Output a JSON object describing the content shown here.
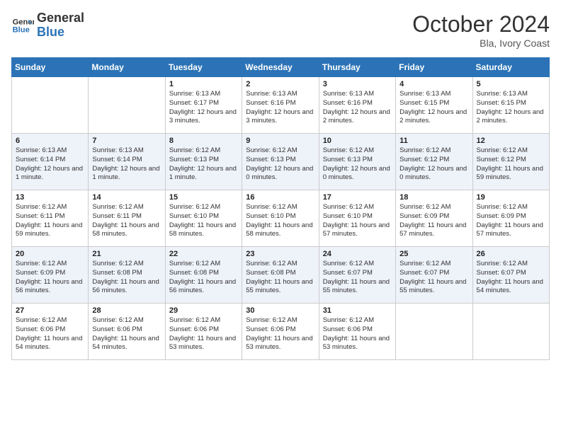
{
  "header": {
    "logo_line1": "General",
    "logo_line2": "Blue",
    "month_title": "October 2024",
    "location": "Bla, Ivory Coast"
  },
  "days_of_week": [
    "Sunday",
    "Monday",
    "Tuesday",
    "Wednesday",
    "Thursday",
    "Friday",
    "Saturday"
  ],
  "weeks": [
    [
      {
        "day": "",
        "info": ""
      },
      {
        "day": "",
        "info": ""
      },
      {
        "day": "1",
        "sunrise": "6:13 AM",
        "sunset": "6:17 PM",
        "daylight": "12 hours and 3 minutes."
      },
      {
        "day": "2",
        "sunrise": "6:13 AM",
        "sunset": "6:16 PM",
        "daylight": "12 hours and 3 minutes."
      },
      {
        "day": "3",
        "sunrise": "6:13 AM",
        "sunset": "6:16 PM",
        "daylight": "12 hours and 2 minutes."
      },
      {
        "day": "4",
        "sunrise": "6:13 AM",
        "sunset": "6:15 PM",
        "daylight": "12 hours and 2 minutes."
      },
      {
        "day": "5",
        "sunrise": "6:13 AM",
        "sunset": "6:15 PM",
        "daylight": "12 hours and 2 minutes."
      }
    ],
    [
      {
        "day": "6",
        "sunrise": "6:13 AM",
        "sunset": "6:14 PM",
        "daylight": "12 hours and 1 minute."
      },
      {
        "day": "7",
        "sunrise": "6:13 AM",
        "sunset": "6:14 PM",
        "daylight": "12 hours and 1 minute."
      },
      {
        "day": "8",
        "sunrise": "6:12 AM",
        "sunset": "6:13 PM",
        "daylight": "12 hours and 1 minute."
      },
      {
        "day": "9",
        "sunrise": "6:12 AM",
        "sunset": "6:13 PM",
        "daylight": "12 hours and 0 minutes."
      },
      {
        "day": "10",
        "sunrise": "6:12 AM",
        "sunset": "6:13 PM",
        "daylight": "12 hours and 0 minutes."
      },
      {
        "day": "11",
        "sunrise": "6:12 AM",
        "sunset": "6:12 PM",
        "daylight": "12 hours and 0 minutes."
      },
      {
        "day": "12",
        "sunrise": "6:12 AM",
        "sunset": "6:12 PM",
        "daylight": "11 hours and 59 minutes."
      }
    ],
    [
      {
        "day": "13",
        "sunrise": "6:12 AM",
        "sunset": "6:11 PM",
        "daylight": "11 hours and 59 minutes."
      },
      {
        "day": "14",
        "sunrise": "6:12 AM",
        "sunset": "6:11 PM",
        "daylight": "11 hours and 58 minutes."
      },
      {
        "day": "15",
        "sunrise": "6:12 AM",
        "sunset": "6:10 PM",
        "daylight": "11 hours and 58 minutes."
      },
      {
        "day": "16",
        "sunrise": "6:12 AM",
        "sunset": "6:10 PM",
        "daylight": "11 hours and 58 minutes."
      },
      {
        "day": "17",
        "sunrise": "6:12 AM",
        "sunset": "6:10 PM",
        "daylight": "11 hours and 57 minutes."
      },
      {
        "day": "18",
        "sunrise": "6:12 AM",
        "sunset": "6:09 PM",
        "daylight": "11 hours and 57 minutes."
      },
      {
        "day": "19",
        "sunrise": "6:12 AM",
        "sunset": "6:09 PM",
        "daylight": "11 hours and 57 minutes."
      }
    ],
    [
      {
        "day": "20",
        "sunrise": "6:12 AM",
        "sunset": "6:09 PM",
        "daylight": "11 hours and 56 minutes."
      },
      {
        "day": "21",
        "sunrise": "6:12 AM",
        "sunset": "6:08 PM",
        "daylight": "11 hours and 56 minutes."
      },
      {
        "day": "22",
        "sunrise": "6:12 AM",
        "sunset": "6:08 PM",
        "daylight": "11 hours and 56 minutes."
      },
      {
        "day": "23",
        "sunrise": "6:12 AM",
        "sunset": "6:08 PM",
        "daylight": "11 hours and 55 minutes."
      },
      {
        "day": "24",
        "sunrise": "6:12 AM",
        "sunset": "6:07 PM",
        "daylight": "11 hours and 55 minutes."
      },
      {
        "day": "25",
        "sunrise": "6:12 AM",
        "sunset": "6:07 PM",
        "daylight": "11 hours and 55 minutes."
      },
      {
        "day": "26",
        "sunrise": "6:12 AM",
        "sunset": "6:07 PM",
        "daylight": "11 hours and 54 minutes."
      }
    ],
    [
      {
        "day": "27",
        "sunrise": "6:12 AM",
        "sunset": "6:06 PM",
        "daylight": "11 hours and 54 minutes."
      },
      {
        "day": "28",
        "sunrise": "6:12 AM",
        "sunset": "6:06 PM",
        "daylight": "11 hours and 54 minutes."
      },
      {
        "day": "29",
        "sunrise": "6:12 AM",
        "sunset": "6:06 PM",
        "daylight": "11 hours and 53 minutes."
      },
      {
        "day": "30",
        "sunrise": "6:12 AM",
        "sunset": "6:06 PM",
        "daylight": "11 hours and 53 minutes."
      },
      {
        "day": "31",
        "sunrise": "6:12 AM",
        "sunset": "6:06 PM",
        "daylight": "11 hours and 53 minutes."
      },
      {
        "day": "",
        "info": ""
      },
      {
        "day": "",
        "info": ""
      }
    ]
  ],
  "labels": {
    "sunrise": "Sunrise:",
    "sunset": "Sunset:",
    "daylight": "Daylight:"
  }
}
